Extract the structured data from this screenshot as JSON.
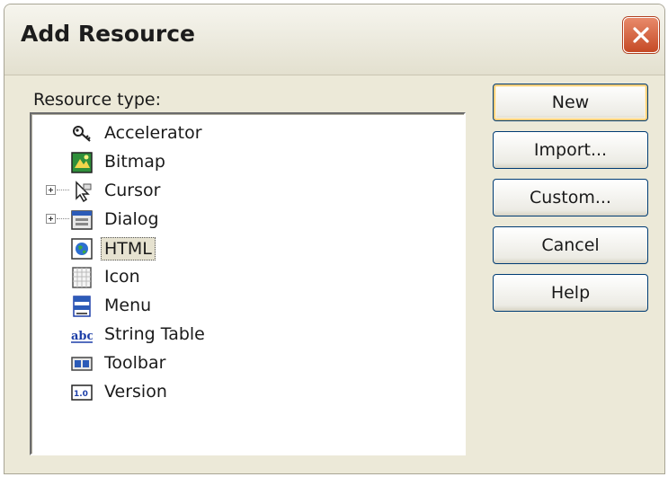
{
  "window": {
    "title": "Add Resource"
  },
  "tree_label": "Resource type:",
  "tree_items": [
    {
      "label": "Accelerator",
      "icon": "accelerator-icon",
      "expandable": false
    },
    {
      "label": "Bitmap",
      "icon": "bitmap-icon",
      "expandable": false
    },
    {
      "label": "Cursor",
      "icon": "cursor-icon",
      "expandable": true
    },
    {
      "label": "Dialog",
      "icon": "dialog-icon",
      "expandable": true
    },
    {
      "label": "HTML",
      "icon": "html-icon",
      "expandable": false,
      "selected": true
    },
    {
      "label": "Icon",
      "icon": "icon-resource-icon",
      "expandable": false
    },
    {
      "label": "Menu",
      "icon": "menu-icon",
      "expandable": false
    },
    {
      "label": "String Table",
      "icon": "string-table-icon",
      "expandable": false
    },
    {
      "label": "Toolbar",
      "icon": "toolbar-icon",
      "expandable": false
    },
    {
      "label": "Version",
      "icon": "version-icon",
      "expandable": false
    }
  ],
  "buttons": {
    "new": "New",
    "import": "Import...",
    "custom": "Custom...",
    "cancel": "Cancel",
    "help": "Help"
  },
  "colors": {
    "dialog_bg": "#ece9d8",
    "close_button": "#c54a26",
    "default_button_glow": "#f7ce7a"
  }
}
